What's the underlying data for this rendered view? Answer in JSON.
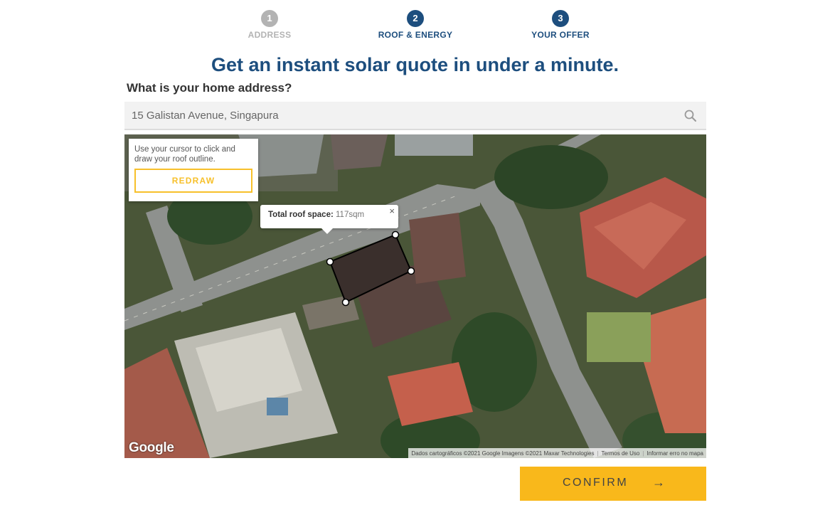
{
  "steps": [
    {
      "number": "1",
      "label": "ADDRESS",
      "state": "done"
    },
    {
      "number": "2",
      "label": "ROOF & ENERGY",
      "state": "active"
    },
    {
      "number": "3",
      "label": "YOUR OFFER",
      "state": "active"
    }
  ],
  "headline": "Get an instant solar quote in under a minute.",
  "question": "What is your home address?",
  "address": {
    "value": "15 Galistan Avenue, Singapura",
    "icon": "search-icon"
  },
  "map": {
    "hint_text": "Use your cursor to click and draw your roof outline.",
    "redraw_label": "REDRAW",
    "roof_space_label": "Total roof space:",
    "roof_space_value": "117sqm",
    "close_symbol": "×",
    "google_logo": "Google",
    "attribution": {
      "data": "Dados cartográficos ©2021 Google Imagens ©2021 Maxar Technologies",
      "terms": "Termos de Uso",
      "report": "Informar erro no mapa"
    }
  },
  "confirm": {
    "label": "CONFIRM",
    "arrow": "→"
  },
  "colors": {
    "brand_blue": "#1d4e7e",
    "accent_yellow": "#f9b81b",
    "step_done": "#b3b3b3"
  }
}
